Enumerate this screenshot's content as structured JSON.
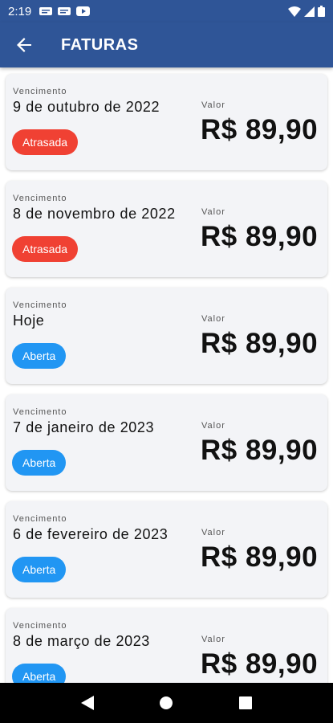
{
  "status_bar": {
    "time": "2:19",
    "left_icons": [
      "notification-icon",
      "notification-icon",
      "youtube-icon"
    ],
    "right_icons": [
      "wifi-icon",
      "signal-icon",
      "battery-icon"
    ]
  },
  "app_bar": {
    "title": "FATURAS",
    "back_icon": "arrow-back-icon",
    "color": "#2f5597"
  },
  "colors": {
    "atrasada": "#f04133",
    "aberta": "#2196f3"
  },
  "invoices": [
    {
      "vencimento_label": "Vencimento",
      "date": "9 de outubro de 2022",
      "status": "Atrasada",
      "status_type": "atrasada",
      "valor_label": "Valor",
      "amount": "R$ 89,90"
    },
    {
      "vencimento_label": "Vencimento",
      "date": "8 de novembro de 2022",
      "status": "Atrasada",
      "status_type": "atrasada",
      "valor_label": "Valor",
      "amount": "R$ 89,90"
    },
    {
      "vencimento_label": "Vencimento",
      "date": "Hoje",
      "status": "Aberta",
      "status_type": "aberta",
      "valor_label": "Valor",
      "amount": "R$ 89,90"
    },
    {
      "vencimento_label": "Vencimento",
      "date": "7 de janeiro de 2023",
      "status": "Aberta",
      "status_type": "aberta",
      "valor_label": "Valor",
      "amount": "R$ 89,90"
    },
    {
      "vencimento_label": "Vencimento",
      "date": "6 de fevereiro de 2023",
      "status": "Aberta",
      "status_type": "aberta",
      "valor_label": "Valor",
      "amount": "R$ 89,90"
    },
    {
      "vencimento_label": "Vencimento",
      "date": "8 de março de 2023",
      "status": "Aberta",
      "status_type": "aberta",
      "valor_label": "Valor",
      "amount": "R$ 89,90"
    }
  ],
  "nav_bar": {
    "buttons": [
      "back-triangle-icon",
      "home-circle-icon",
      "recents-square-icon"
    ]
  }
}
